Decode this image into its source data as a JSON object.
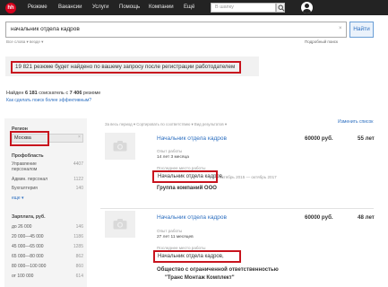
{
  "nav": {
    "logo": "hh",
    "items": [
      "Резюме",
      "Вакансии",
      "Услуги",
      "Помощь",
      "Компании",
      "Ещё"
    ],
    "search_placeholder": "В шапку"
  },
  "search": {
    "query": "начальник отдела кадров",
    "clear": "×",
    "button": "Найти",
    "hints": "Все слова ▾   везде ▾",
    "advanced": "Подробный поиск"
  },
  "banner": {
    "text": "19 821 резюме будет найдено по вашему запросу после регистрации работодателем"
  },
  "found": {
    "prefix": "Найден ",
    "count": "6 181",
    "middle": " соискатель с ",
    "total": "7 406",
    "suffix": " резюме",
    "effective_link": "Как сделать поиск более эффективным?"
  },
  "sidebar": {
    "region_heading": "Регион",
    "region_value": "Москва",
    "region_clear": "×",
    "prof_heading": "Профобласть",
    "prof_items": [
      {
        "label": "Управление",
        "count": "4407"
      },
      {
        "label": "персоналом",
        "count": ""
      },
      {
        "label": "Админ. персонал",
        "count": "1122"
      },
      {
        "label": "Бухгалтерия",
        "count": "140"
      },
      {
        "label": "еще ▾",
        "count": ""
      }
    ],
    "salary_heading": "Зарплата, руб.",
    "salary_items": [
      {
        "label": "до 26 000",
        "count": "146"
      },
      {
        "label": "20 000—45 000",
        "count": "1186"
      },
      {
        "label": "45 000—65 000",
        "count": "1285"
      },
      {
        "label": "65 000—80 000",
        "count": "862"
      },
      {
        "label": "80 000—100 000",
        "count": "860"
      },
      {
        "label": "от 100 000",
        "count": "614"
      }
    ]
  },
  "toolbar": {
    "text": "За весь период ▾  Сортировать по соответствию ▾  Вид результатов ▾",
    "change_list": "Изменить список"
  },
  "results": [
    {
      "title": "Начальник отдела кадров",
      "salary": "60000 руб.",
      "age": "55 лет",
      "exp_label": "Опыт работы",
      "exp_value": "14 лет 3 месяца",
      "last_label": "Последнее место работы",
      "last_position": "Начальник отдела кадров,",
      "last_period": "октябрь 2015 — октябрь 2017",
      "company": "Группа компаний ООО"
    },
    {
      "title": "Начальник отдела кадров",
      "salary": "60000 руб.",
      "age": "48 лет",
      "exp_label": "Опыт работы",
      "exp_value": "27 лет 11 месяцев",
      "last_label": "Последнее место работы",
      "last_position": "Начальник отдела кадров,",
      "last_period": "",
      "company": "Общество с ограниченной ответственностью",
      "company2": "\"Транс Монтаж Комплект\""
    }
  ]
}
